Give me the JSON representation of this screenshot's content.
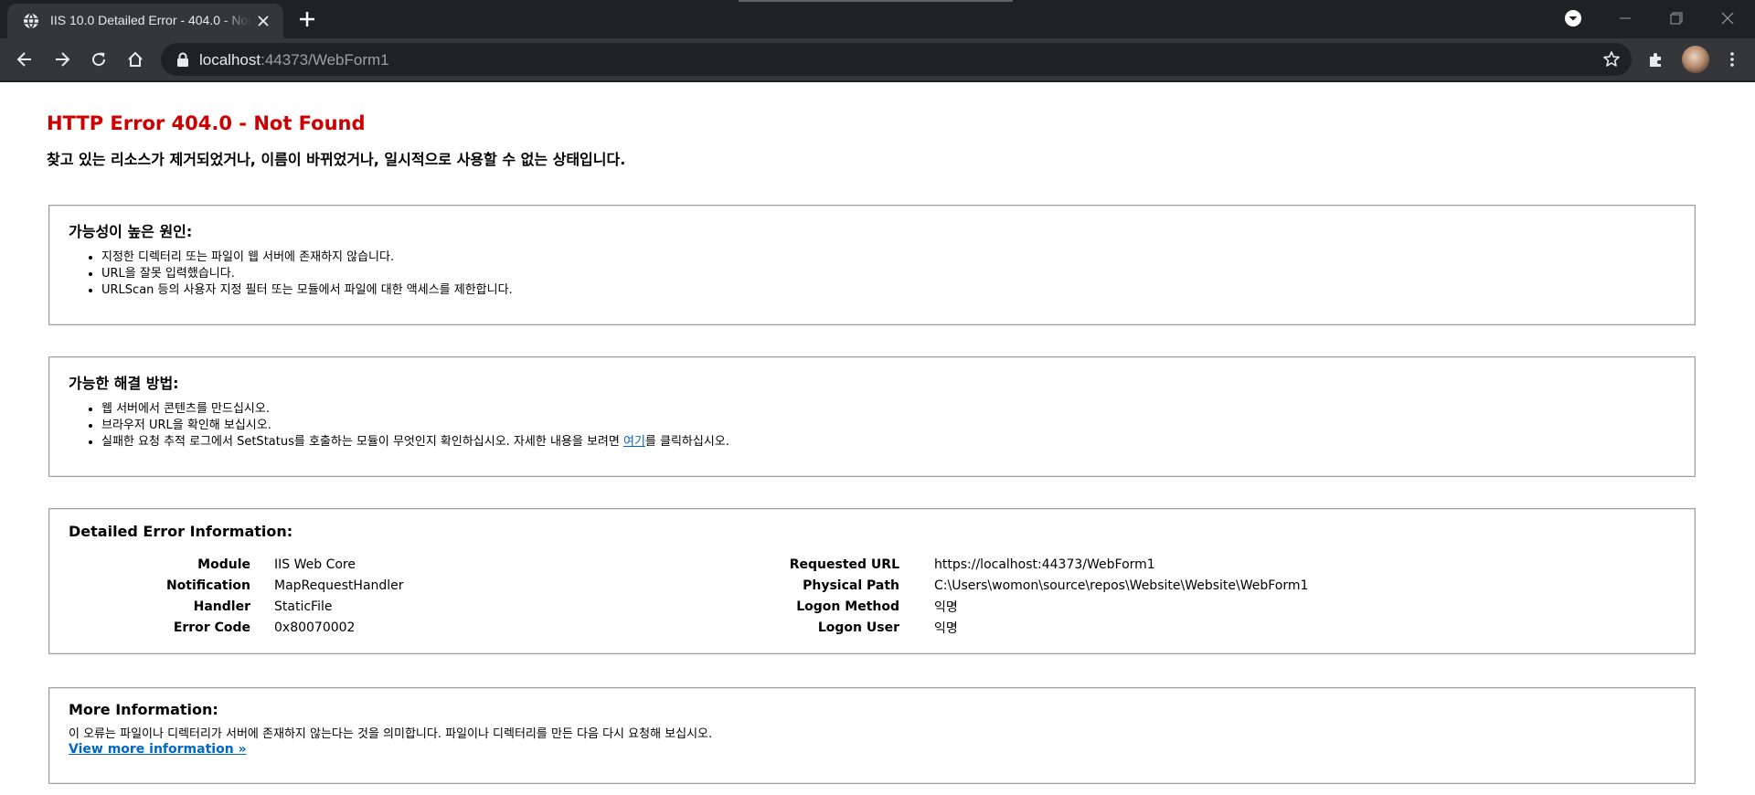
{
  "browser": {
    "tab": {
      "title": "IIS 10.0 Detailed Error - 404.0 - Not Found",
      "icon": "globe-icon"
    },
    "new_tab_icon": "plus-icon",
    "window_buttons": [
      "minimize-icon",
      "restore-icon",
      "close-icon"
    ],
    "nav": {
      "back_icon": "arrow-left-icon",
      "forward_icon": "arrow-right-icon",
      "reload_icon": "reload-icon",
      "home_icon": "home-icon"
    },
    "address": {
      "host": "localhost",
      "rest": ":44373/WebForm1"
    }
  },
  "page": {
    "title": "HTTP Error 404.0 - Not Found",
    "subtitle": "찾고 있는 리소스가 제거되었거나, 이름이 바뀌었거나, 일시적으로 사용할 수 없는 상태입니다.",
    "causes": {
      "heading": "가능성이 높은 원인:",
      "items": [
        "지정한 디렉터리 또는 파일이 웹 서버에 존재하지 않습니다.",
        "URL을 잘못 입력했습니다.",
        "URLScan 등의 사용자 지정 필터 또는 모듈에서 파일에 대한 액세스를 제한합니다."
      ]
    },
    "solutions": {
      "heading": "가능한 해결 방법:",
      "items": [
        "웹 서버에서 콘텐츠를 만드십시오.",
        "브라우저 URL을 확인해 보십시오."
      ],
      "item3_before": "실패한 요청 추적 로그에서 SetStatus를 호출하는 모듈이 무엇인지 확인하십시오. 자세한 내용을 보려면 ",
      "item3_link": "여기",
      "item3_after": "를 클릭하십시오."
    },
    "detail": {
      "heading": "Detailed Error Information:",
      "left": [
        {
          "label": "Module",
          "value": "IIS Web Core"
        },
        {
          "label": "Notification",
          "value": "MapRequestHandler"
        },
        {
          "label": "Handler",
          "value": "StaticFile"
        },
        {
          "label": "Error Code",
          "value": "0x80070002"
        }
      ],
      "right": [
        {
          "label": "Requested URL",
          "value": "https://localhost:44373/WebForm1"
        },
        {
          "label": "Physical Path",
          "value": "C:\\Users\\womon\\source\\repos\\Website\\Website\\WebForm1"
        },
        {
          "label": "Logon Method",
          "value": "익명"
        },
        {
          "label": "Logon User",
          "value": "익명"
        }
      ]
    },
    "more": {
      "heading": "More Information:",
      "text": "이 오류는 파일이나 디렉터리가 서버에 존재하지 않는다는 것을 의미합니다. 파일이나 디렉터리를 만든 다음 다시 요청해 보십시오.",
      "link": "View more information »"
    }
  },
  "colors": {
    "error_title": "#cc0000",
    "link": "#0066cc",
    "chrome_dark": "#202124",
    "chrome_toolbar": "#35363a"
  }
}
